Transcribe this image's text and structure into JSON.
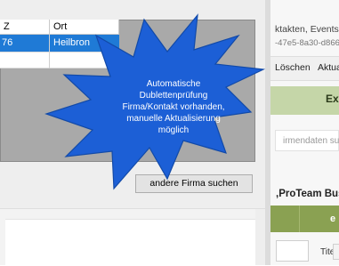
{
  "grid": {
    "columns": [
      "Z",
      "Ort"
    ],
    "rows": [
      {
        "nr": "76",
        "ort": "Heilbron",
        "selected": true
      },
      {
        "nr": "",
        "ort": "",
        "selected": false
      }
    ]
  },
  "buttons": {
    "other_company": "andere Firma suchen"
  },
  "callout": {
    "lines": [
      "Automatische",
      "Dublettenprüfung",
      "Firma/Kontakt vorhanden,",
      "manuelle Aktualisierung",
      "möglich"
    ]
  },
  "right_panel": {
    "title": "ktakten, Events ...",
    "guid": "-47e5-8a30-d8667",
    "toolbar": {
      "delete": "Löschen",
      "update": "Aktua"
    },
    "green_section_label": "Ex",
    "search_placeholder": "irmendaten such",
    "company_name": ",ProTeam Busin",
    "olive_label": "e",
    "title_label": "Titel"
  },
  "colors": {
    "selection": "#1f7ad6",
    "callout": "#1c5fd6",
    "green": "#c5d6a8",
    "olive": "#8aa152"
  }
}
